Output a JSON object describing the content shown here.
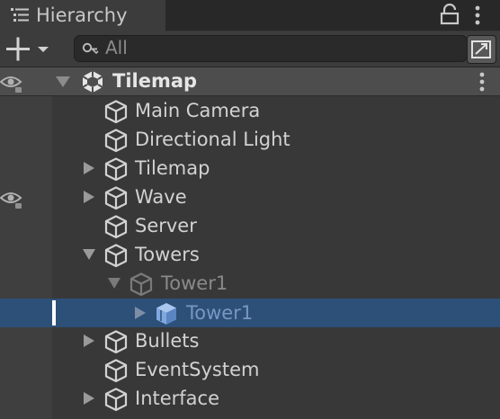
{
  "panel": {
    "title": "Hierarchy"
  },
  "search": {
    "placeholder": "All",
    "value": ""
  },
  "scene": {
    "name": "Tilemap"
  },
  "items": [
    {
      "label": "Main Camera",
      "depth": 1,
      "expandable": false,
      "expanded": false,
      "state": "normal"
    },
    {
      "label": "Directional Light",
      "depth": 1,
      "expandable": false,
      "expanded": false,
      "state": "normal"
    },
    {
      "label": "Tilemap",
      "depth": 1,
      "expandable": true,
      "expanded": false,
      "state": "normal"
    },
    {
      "label": "Wave",
      "depth": 1,
      "expandable": true,
      "expanded": false,
      "state": "normal",
      "visibility_icon": "eye-icon"
    },
    {
      "label": "Server",
      "depth": 1,
      "expandable": false,
      "expanded": false,
      "state": "normal"
    },
    {
      "label": "Towers",
      "depth": 1,
      "expandable": true,
      "expanded": true,
      "state": "normal"
    },
    {
      "label": "Tower1",
      "depth": 2,
      "expandable": true,
      "expanded": true,
      "state": "inactive"
    },
    {
      "label": "Tower1",
      "depth": 3,
      "expandable": true,
      "expanded": false,
      "state": "prefab-selected"
    },
    {
      "label": "Bullets",
      "depth": 1,
      "expandable": true,
      "expanded": false,
      "state": "normal"
    },
    {
      "label": "EventSystem",
      "depth": 1,
      "expandable": false,
      "expanded": false,
      "state": "normal"
    },
    {
      "label": "Interface",
      "depth": 1,
      "expandable": true,
      "expanded": false,
      "state": "normal"
    }
  ],
  "colors": {
    "background": "#383838",
    "gutter": "#3f3f3f",
    "scene_header": "#4d4d4d",
    "selection": "#2d5078",
    "text": "#d2d2d2",
    "inactive_text": "#8a8a8a",
    "prefab_text": "#7897c4"
  }
}
